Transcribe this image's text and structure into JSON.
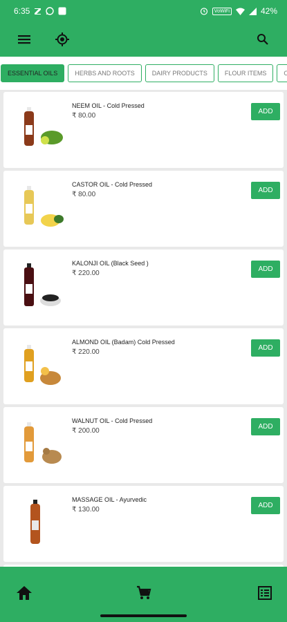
{
  "status_bar": {
    "time": "6:35",
    "carrier_tag": "VoWiFi",
    "battery": "42%"
  },
  "tabs": [
    {
      "label": "ESSENTIAL OILS",
      "active": true
    },
    {
      "label": "HERBS AND ROOTS",
      "active": false
    },
    {
      "label": "DAIRY PRODUCTS",
      "active": false
    },
    {
      "label": "FLOUR  ITEMS",
      "active": false
    },
    {
      "label": "ORG",
      "active": false
    }
  ],
  "products": [
    {
      "name": "NEEM OIL - Cold Pressed",
      "price": "₹ 80.00",
      "add_label": "ADD",
      "liquid_color": "#8b3a1a",
      "garnish_color": "#5a9a2a"
    },
    {
      "name": "CASTOR OIL - Cold Pressed",
      "price": "₹ 80.00",
      "add_label": "ADD",
      "liquid_color": "#e7c857",
      "garnish_color": "#3d7a2a"
    },
    {
      "name": "KALONJI OIL  (Black Seed )",
      "price": "₹ 220.00",
      "add_label": "ADD",
      "liquid_color": "#4a0f12",
      "garnish_color": "#222222"
    },
    {
      "name": "ALMOND OIL (Badam)  Cold Pressed",
      "price": "₹ 220.00",
      "add_label": "ADD",
      "liquid_color": "#e0a020",
      "garnish_color": "#c7883a"
    },
    {
      "name": "WALNUT OIL - Cold Pressed",
      "price": "₹ 200.00",
      "add_label": "ADD",
      "liquid_color": "#e29a3a",
      "garnish_color": "#b88a50"
    },
    {
      "name": "MASSAGE OIL - Ayurvedic",
      "price": "₹ 130.00",
      "add_label": "ADD",
      "liquid_color": "#b3541e",
      "garnish_color": "#e8e8e8"
    }
  ],
  "icons": {
    "menu": "menu-icon",
    "location": "gps-target-icon",
    "search": "search-icon",
    "home": "home-icon",
    "cart": "cart-icon",
    "orders": "list-icon"
  },
  "colors": {
    "primary": "#2eae62",
    "background": "#e9e9e9",
    "card": "#ffffff"
  }
}
